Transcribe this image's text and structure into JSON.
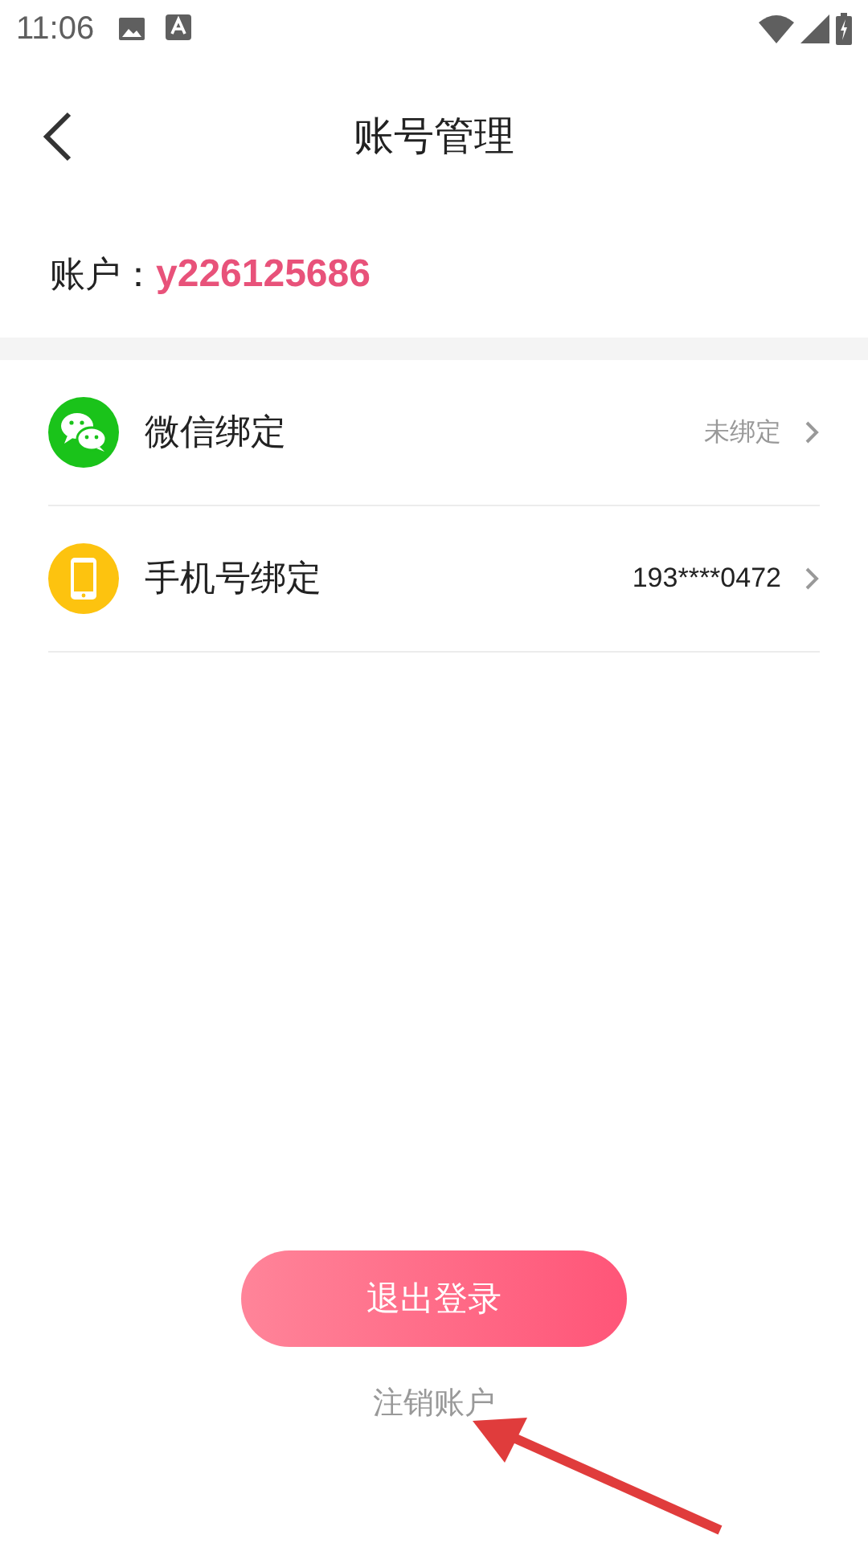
{
  "status_bar": {
    "time": "11:06"
  },
  "header": {
    "title": "账号管理"
  },
  "account": {
    "label": "账户：",
    "value": "y226125686"
  },
  "bindings": [
    {
      "kind": "wechat",
      "label": "微信绑定",
      "value": "未绑定",
      "bound": false
    },
    {
      "kind": "phone",
      "label": "手机号绑定",
      "value": "193****0472",
      "bound": true
    }
  ],
  "logout_button": "退出登录",
  "cancel_link": "注销账户"
}
